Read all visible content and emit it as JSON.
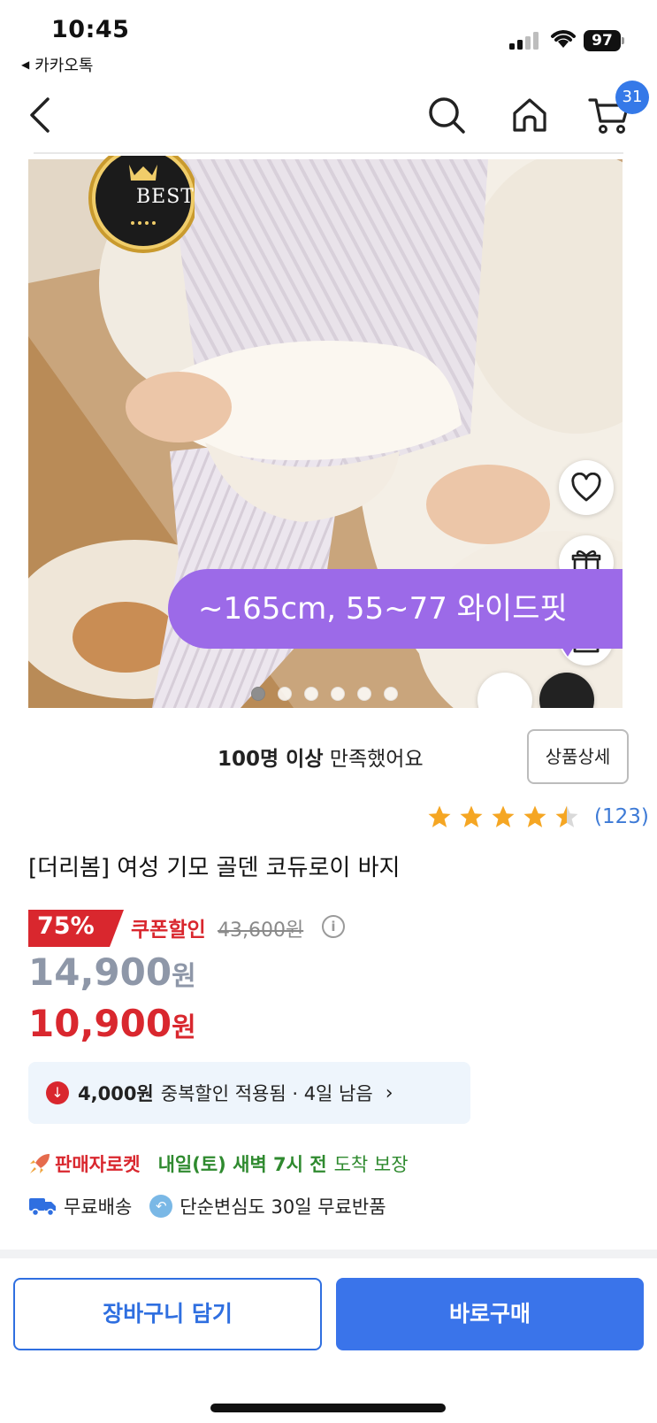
{
  "status_bar": {
    "time": "10:45",
    "back_app": "카카오톡",
    "battery": "97"
  },
  "nav": {
    "cart_count": "31"
  },
  "hero": {
    "best_badge": "BEST",
    "promo_text": "~165cm, 55~77 와이드핏",
    "page_dots": 6,
    "active_dot": 0
  },
  "summary": {
    "satisfaction_bold": "100명 이상",
    "satisfaction_rest": " 만족했어요",
    "detail_button": "상품상세"
  },
  "rating": {
    "stars": 4.5,
    "count": "(123)"
  },
  "product": {
    "title": "[더리봄] 여성 기모 골덴 코듀로이 바지"
  },
  "price": {
    "discount_rate": "75%",
    "coupon_label": "쿠폰할인",
    "original": "43,600원",
    "sale_amount": "14,900",
    "final_amount": "10,900",
    "unit": "원"
  },
  "duplicate_discount": {
    "amount": "4,000원",
    "text": "중복할인 적용됨 · 4일 남음"
  },
  "delivery": {
    "rocket_brand": "판매자로켓",
    "eta": "내일(토) 새벽 7시 전",
    "guarantee": "도착 보장",
    "free_shipping": "무료배송",
    "free_return": "단순변심도 30일 무료반품"
  },
  "actions": {
    "add_to_cart": "장바구니 담기",
    "buy_now": "바로구매"
  },
  "colors": {
    "accent_blue": "#3a74ea",
    "price_red": "#d9272e",
    "promo_purple": "#9c6ae8",
    "delivery_green": "#2f8a2f"
  }
}
